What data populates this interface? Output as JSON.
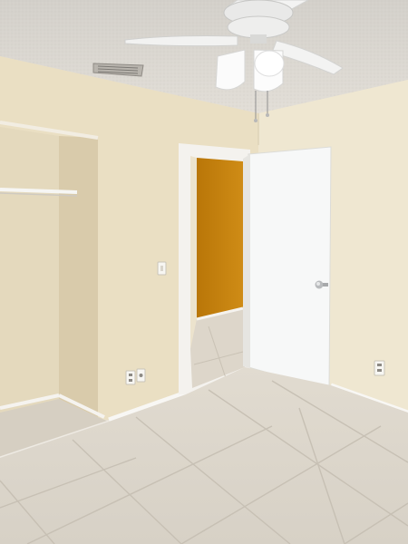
{
  "scene": {
    "description_free": true,
    "colors": {
      "ceiling": "#d9d6d0",
      "wall_left": "#e9dfc4",
      "wall_right": "#eee6cf",
      "closet_inner": "#e3d8bc",
      "closet_side": "#d8cbaa",
      "hall_wall": "#c9860f",
      "door": "#f6f7f7",
      "trim": "#f4f2ee",
      "floor": "#d9d3c9",
      "grout": "#c8c1b5",
      "fan": "#f4f4f4"
    },
    "icons": [
      "ceiling-fan-icon",
      "air-vent-icon",
      "light-switch-icon",
      "outlet-icon",
      "door-knob-icon"
    ]
  }
}
